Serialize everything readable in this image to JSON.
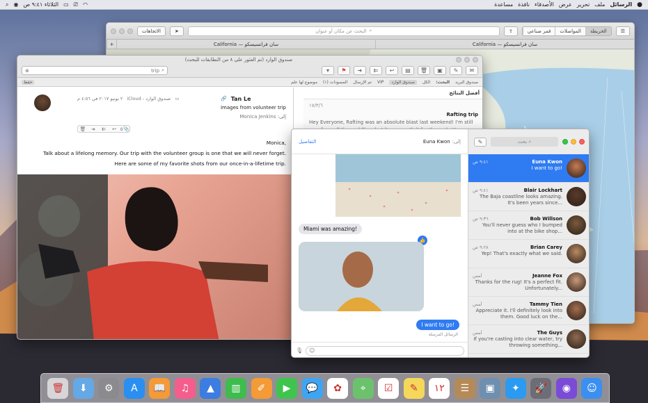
{
  "menubar": {
    "apple": "",
    "app_name": "الرسائل",
    "items": [
      "ملف",
      "تحرير",
      "عرض",
      "الأصدقاء",
      "نافذة",
      "مساعدة"
    ],
    "clock": "الثلاثاء ٩:٤١ ص"
  },
  "maps": {
    "directions_label": "الاتجاهات",
    "search_placeholder": "البحث عن مكان أو عنوان",
    "segments": [
      "الخريطة",
      "المواصلات",
      "قمر صناعي"
    ],
    "selected_segment": "الخريطة",
    "tabs": [
      "California — سان فرانسيسكو",
      "California — سان فرانسيسكو"
    ]
  },
  "mail": {
    "title": "صندوق الوارد (تم العثور على ٨ من التطابقات للبحث)",
    "search_value": "trip",
    "scope": {
      "label": "البحث:",
      "items": [
        "الكل",
        "صندوق الوارد",
        "VIP",
        "تم الإرسال",
        "المسودات (١)",
        "موضوع لها علم"
      ],
      "selected": "صندوق الوارد",
      "mailbox_label": "صندوق البريد",
      "save_label": "حفظ"
    },
    "message": {
      "sender": "Tan Le",
      "meta": "صندوق الوارد - iCloud",
      "date": "٢ يونيو ٢٠١٧ في ٤:٥٦ م",
      "subject": "Images from volunteer trip",
      "to_label": "إلى:",
      "to": "Monica Jenkins",
      "attachment_count": "٥",
      "body": [
        "Monica,",
        "Talk about a lifelong memory. Our trip with the volunteer group is one that we will never forget.",
        "Here are some of my favorite shots from our once-in-a-lifetime trip."
      ]
    },
    "results": {
      "header": "أفضل النتائج",
      "item": {
        "date": "١٧/٣/٦",
        "subject": "Rafting trip",
        "preview": "Hey Everyone, Rafting was an absolute blast last weekend! I'm still sore from all the paddling, but it was worth it for the rush. Here are..."
      }
    }
  },
  "messages": {
    "to_label": "إلى:",
    "to_name": "Euna Kwon",
    "details_label": "التفاصيل",
    "search_placeholder": "بحث",
    "bubbles": {
      "incoming": "Miami was amazing!",
      "outgoing": "I want to go!",
      "delivered": "الرسائل المرسلة"
    },
    "chats": [
      {
        "name": "Euna Kwon",
        "time": "٩:٤١ ص",
        "preview": "I want to go!",
        "color": "#c77b52"
      },
      {
        "name": "Blair Lockhart",
        "time": "٩:٤١ ص",
        "preview": "The Baja coastline looks amazing. It's been years since...",
        "color": "#5a3a2a"
      },
      {
        "name": "Bob Willson",
        "time": "٩:٣٦ ص",
        "preview": "You'll never guess who I bumped into at the bike shop...",
        "color": "#7a5a3c"
      },
      {
        "name": "Brian Carey",
        "time": "٩:٢٨ ص",
        "preview": "Yep! That's exactly what we said.",
        "color": "#b98a62"
      },
      {
        "name": "Jeanne Fox",
        "time": "أمس",
        "preview": "Thanks for the rug! It's a perfect fit. Unfortunately...",
        "color": "#c99a7a"
      },
      {
        "name": "Tammy Tien",
        "time": "أمس",
        "preview": "Appreciate it. I'll definitely look into them. Good luck on the...",
        "color": "#a46e50"
      },
      {
        "name": "The Guys",
        "time": "أمس",
        "preview": "If you're casting into clear water, try throwing something...",
        "color": "#8e6a50"
      }
    ]
  },
  "dock": {
    "apps": [
      {
        "name": "finder",
        "color": "#3b8ff0",
        "glyph": "☺"
      },
      {
        "name": "siri",
        "color": "#7a4bd6",
        "glyph": "◉"
      },
      {
        "name": "launchpad",
        "color": "#6d6d78",
        "glyph": "🚀"
      },
      {
        "name": "safari",
        "color": "#2a9bf0",
        "glyph": "✦"
      },
      {
        "name": "preview",
        "color": "#6f8fb0",
        "glyph": "▣"
      },
      {
        "name": "contacts",
        "color": "#b48a58",
        "glyph": "☰"
      },
      {
        "name": "calendar",
        "color": "#ffffff",
        "glyph": "١٢"
      },
      {
        "name": "notes",
        "color": "#f5d75a",
        "glyph": "✎"
      },
      {
        "name": "reminders",
        "color": "#ffffff",
        "glyph": "☑"
      },
      {
        "name": "maps",
        "color": "#6cc26c",
        "glyph": "⌖"
      },
      {
        "name": "photos",
        "color": "#ffffff",
        "glyph": "✿"
      },
      {
        "name": "messages",
        "color": "#3ea5f5",
        "glyph": "💬"
      },
      {
        "name": "facetime",
        "color": "#3fc54d",
        "glyph": "▶"
      },
      {
        "name": "pages",
        "color": "#f49a36",
        "glyph": "✐"
      },
      {
        "name": "numbers",
        "color": "#3ebc4c",
        "glyph": "▥"
      },
      {
        "name": "keynote",
        "color": "#3d7ce0",
        "glyph": "▲"
      },
      {
        "name": "itunes",
        "color": "#f55d8c",
        "glyph": "♫"
      },
      {
        "name": "ibooks",
        "color": "#f49a36",
        "glyph": "📖"
      },
      {
        "name": "app-store",
        "color": "#2a8ff0",
        "glyph": "A"
      },
      {
        "name": "system-preferences",
        "color": "#8a8a8f",
        "glyph": "⚙"
      },
      {
        "name": "downloads",
        "color": "#65a8e6",
        "glyph": "⬇"
      },
      {
        "name": "trash",
        "color": "#d6d6d8",
        "glyph": "🗑"
      }
    ]
  }
}
